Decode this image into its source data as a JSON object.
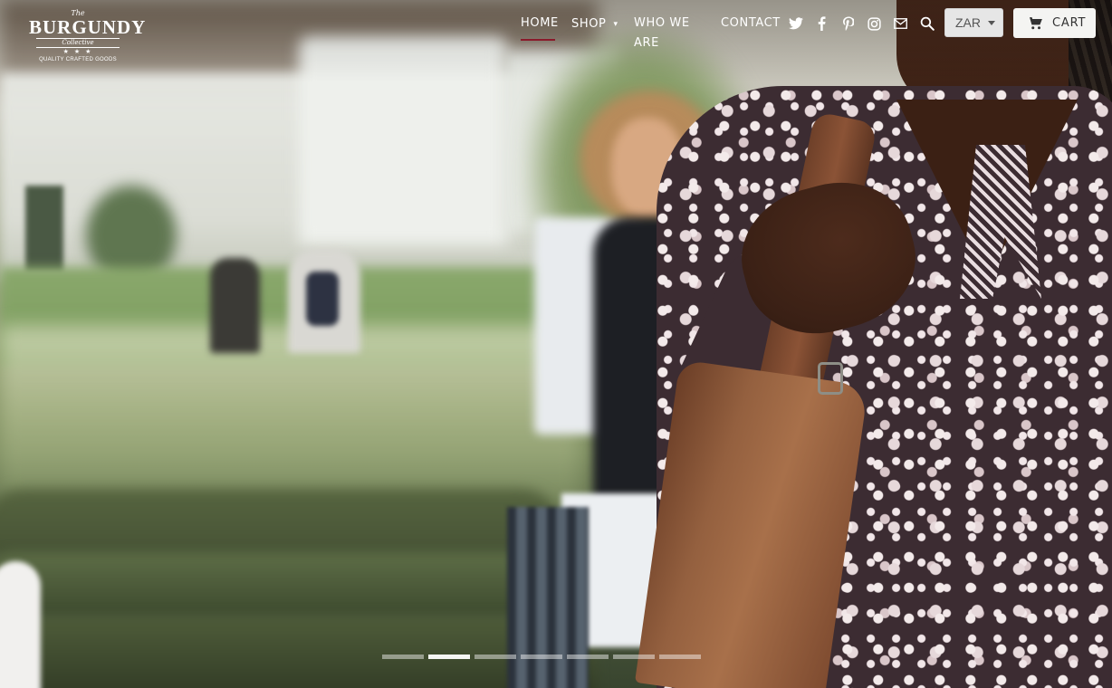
{
  "logo": {
    "the": "The",
    "name": "BURGUNDY",
    "collection": "Collective",
    "stars": "★ ★ ★",
    "tagline": "QUALITY CRAFTED GOODS"
  },
  "nav": {
    "items": [
      {
        "label": "HOME",
        "active": true
      },
      {
        "label": "SHOP",
        "has_dropdown": true
      },
      {
        "label": "WHO WE ARE"
      },
      {
        "label": "CONTACT"
      }
    ],
    "active_color": "#8a1a2b"
  },
  "social_icons": [
    "twitter-icon",
    "facebook-icon",
    "pinterest-icon",
    "instagram-icon",
    "email-icon",
    "search-icon"
  ],
  "currency": {
    "selected": "ZAR"
  },
  "cart": {
    "label": "CART",
    "icon": "cart-icon"
  },
  "slideshow": {
    "total_slides": 7,
    "active_index": 1
  }
}
